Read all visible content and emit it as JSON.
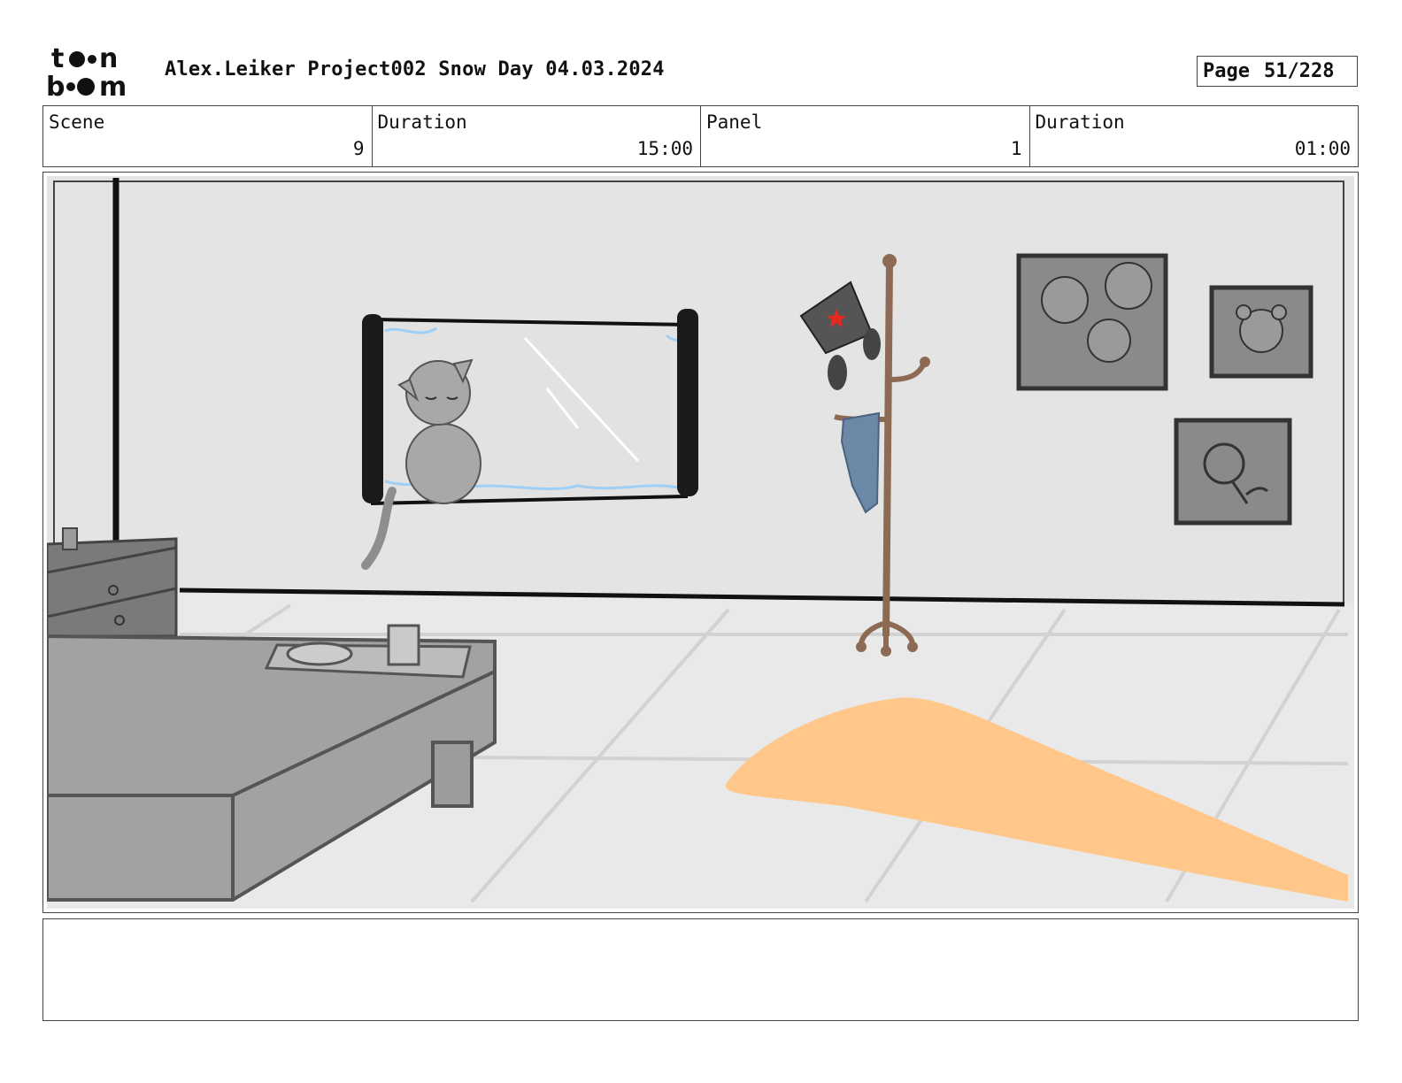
{
  "header": {
    "logo_top": "toon",
    "logo_bottom": "boom",
    "title": "Alex.Leiker Project002 Snow Day 04.03.2024",
    "page_label": "Page",
    "page_value": "51/228"
  },
  "info": {
    "scene_label": "Scene",
    "scene_value": "9",
    "scene_duration_label": "Duration",
    "scene_duration_value": "15:00",
    "panel_label": "Panel",
    "panel_value": "1",
    "panel_duration_label": "Duration",
    "panel_duration_value": "01:00"
  },
  "panel": {
    "image": "storyboard-drawing",
    "colors": {
      "wall": "#e4e4e4",
      "floor": "#e8e8e8",
      "furniture": "#9a9a9a",
      "light": "#ffc88a",
      "coat_rack": "#8c6a54",
      "snow": "#9fcff5",
      "scarf": "#6b89a6",
      "hat_star": "#e8281e"
    }
  },
  "notes": {
    "text": ""
  }
}
